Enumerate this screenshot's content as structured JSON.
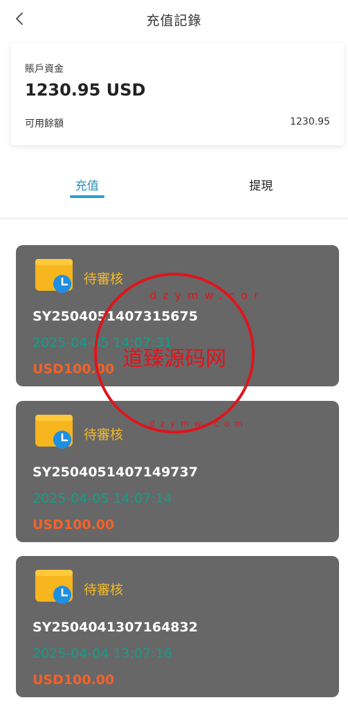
{
  "header": {
    "title": "充值記錄",
    "back_icon": "chevron-left-icon"
  },
  "account": {
    "label": "賬戶資金",
    "amount": "1230.95 USD",
    "available_label": "可用餘額",
    "available_value": "1230.95"
  },
  "tabs": [
    {
      "label": "充值",
      "active": true
    },
    {
      "label": "提現",
      "active": false
    }
  ],
  "records": [
    {
      "status": "待審核",
      "id": "SY2504051407315675",
      "time": "2025-04-05 14:07:31",
      "amount": "USD100.00"
    },
    {
      "status": "待審核",
      "id": "SY2504051407149737",
      "time": "2025-04-05 14:07:14",
      "amount": "USD100.00"
    },
    {
      "status": "待審核",
      "id": "SY2504041307164832",
      "time": "2025-04-04 13:07:16",
      "amount": "USD100.00"
    }
  ],
  "watermark": {
    "text": "道臻源码网",
    "url": "dzymw.com",
    "color": "#e0141b"
  },
  "colors": {
    "accent": "#2a9fd0",
    "card_bg": "#676767",
    "status": "#f3ba28",
    "time": "#139e8c",
    "amount": "#f4622a"
  }
}
